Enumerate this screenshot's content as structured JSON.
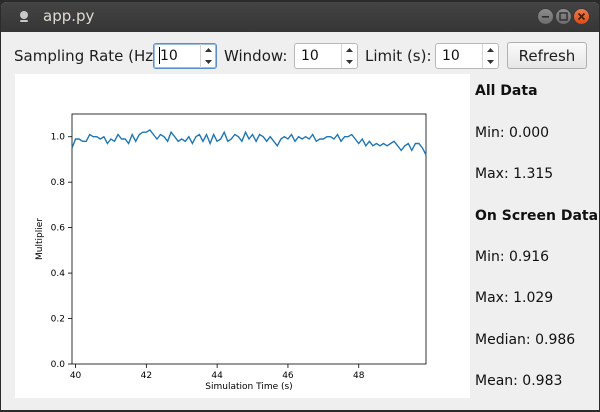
{
  "window": {
    "title": "app.py"
  },
  "controls": {
    "sampling_label": "Sampling Rate (Hz):",
    "sampling_value": "10",
    "window_label": "Window:",
    "window_value": "10",
    "limit_label": "Limit (s):",
    "limit_value": "10",
    "refresh_label": "Refresh"
  },
  "stats": {
    "all_heading": "All Data",
    "all_min": "Min: 0.000",
    "all_max": "Max: 1.315",
    "screen_heading": "On Screen Data",
    "screen_min": "Min: 0.916",
    "screen_max": "Max: 1.029",
    "screen_median": "Median: 0.986",
    "screen_mean": "Mean: 0.983"
  },
  "chart_data": {
    "type": "line",
    "title": "",
    "xlabel": "Simulation Time (s)",
    "ylabel": "Multiplier",
    "xlim": [
      39.9,
      49.9
    ],
    "ylim": [
      0.0,
      1.1
    ],
    "xticks": [
      "40",
      "42",
      "44",
      "46",
      "48"
    ],
    "yticks": [
      "0.0",
      "0.2",
      "0.4",
      "0.6",
      "0.8",
      "1.0"
    ],
    "grid": false,
    "color": "#1f77b4",
    "x": [
      39.9,
      40.0,
      40.1,
      40.2,
      40.3,
      40.4,
      40.5,
      40.6,
      40.7,
      40.8,
      40.9,
      41.0,
      41.1,
      41.2,
      41.3,
      41.4,
      41.5,
      41.6,
      41.7,
      41.8,
      41.9,
      42.0,
      42.1,
      42.2,
      42.3,
      42.4,
      42.5,
      42.6,
      42.7,
      42.8,
      42.9,
      43.0,
      43.1,
      43.2,
      43.3,
      43.4,
      43.5,
      43.6,
      43.7,
      43.8,
      43.9,
      44.0,
      44.1,
      44.2,
      44.3,
      44.4,
      44.5,
      44.6,
      44.7,
      44.8,
      44.9,
      45.0,
      45.1,
      45.2,
      45.3,
      45.4,
      45.5,
      45.6,
      45.7,
      45.8,
      45.9,
      46.0,
      46.1,
      46.2,
      46.3,
      46.4,
      46.5,
      46.6,
      46.7,
      46.8,
      46.9,
      47.0,
      47.1,
      47.2,
      47.3,
      47.4,
      47.5,
      47.6,
      47.7,
      47.8,
      47.9,
      48.0,
      48.1,
      48.2,
      48.3,
      48.4,
      48.5,
      48.6,
      48.7,
      48.8,
      48.9,
      49.0,
      49.1,
      49.2,
      49.3,
      49.4,
      49.5,
      49.6,
      49.7,
      49.8,
      49.9
    ],
    "y": [
      0.95,
      0.99,
      0.99,
      0.98,
      0.98,
      1.01,
      1.0,
      1.0,
      0.99,
      1.0,
      0.97,
      0.99,
      0.98,
      1.01,
      0.99,
      0.99,
      0.97,
      1.01,
      0.98,
      1.01,
      1.02,
      1.02,
      1.03,
      1.01,
      0.99,
      1.01,
      1.0,
      0.98,
      1.02,
      1.0,
      0.98,
      0.99,
      0.98,
      1.0,
      0.97,
      1.0,
      1.01,
      0.98,
      1.01,
      0.97,
      1.01,
      0.98,
      0.99,
      1.02,
      0.98,
      0.99,
      1.01,
      1.0,
      0.98,
      1.02,
      0.99,
      1.01,
      0.98,
      1.01,
      1.0,
      0.98,
      1.0,
      0.98,
      0.96,
      0.99,
      1.0,
      0.99,
      1.01,
      0.98,
      1.0,
      0.99,
      1.0,
      0.99,
      1.01,
      0.98,
      0.99,
      0.99,
      1.0,
      1.0,
      0.99,
      1.01,
      0.98,
      1.0,
      1.0,
      1.01,
      0.99,
      0.97,
      0.99,
      0.96,
      0.98,
      0.96,
      0.97,
      0.96,
      0.97,
      0.96,
      0.97,
      0.98,
      0.96,
      0.94,
      0.96,
      0.97,
      0.94,
      0.97,
      0.97,
      0.95,
      0.92
    ]
  }
}
